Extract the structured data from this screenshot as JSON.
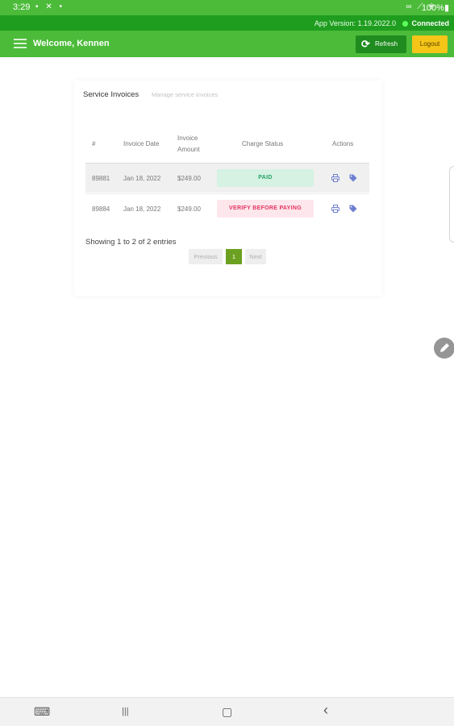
{
  "status_bar": {
    "time": "3:29",
    "left_icons": "▪ ✕ •",
    "right_icons": "∞ ⟋ ◈",
    "battery": "100%▮"
  },
  "info_bar": {
    "app_version": "App Version: 1.19.2022.0",
    "connection": "Connected"
  },
  "navbar": {
    "welcome": "Welcome, Kennen",
    "refresh_label": "Refresh",
    "refresh_icon": "⟳",
    "logout_label": "Logout"
  },
  "card": {
    "title": "Service Invoices",
    "subtitle": "Manage service invoices",
    "columns": {
      "num": "#",
      "date": "Invoice Date",
      "amount_l1": "Invoice",
      "amount_l2": "Amount",
      "status": "Charge Status",
      "actions": "Actions"
    },
    "rows": [
      {
        "num": "89881",
        "date": "Jan 18, 2022",
        "amount": "$249.00",
        "status": "PAID"
      },
      {
        "num": "89884",
        "date": "Jan 18, 2022",
        "amount": "$249.00",
        "status": "VERIFY BEFORE PAYING"
      }
    ],
    "entries_text": "Showing 1 to 2 of 2 entries",
    "pagination": {
      "previous": "Previous",
      "current": "1",
      "next": "Next"
    }
  },
  "colors": {
    "green": "#4cbb3a",
    "dark_green": "#1f9d1f",
    "yellow": "#f5c518",
    "paid_bg": "#d5f2e3",
    "verify_bg": "#fde6ec"
  },
  "icons": {
    "print": "printer-icon",
    "tag": "tag-icon",
    "edit": "pencil-icon"
  },
  "bottom_nav": {
    "keyboard": "⌨",
    "recents": "|||",
    "home": "▢",
    "back": "‹"
  }
}
